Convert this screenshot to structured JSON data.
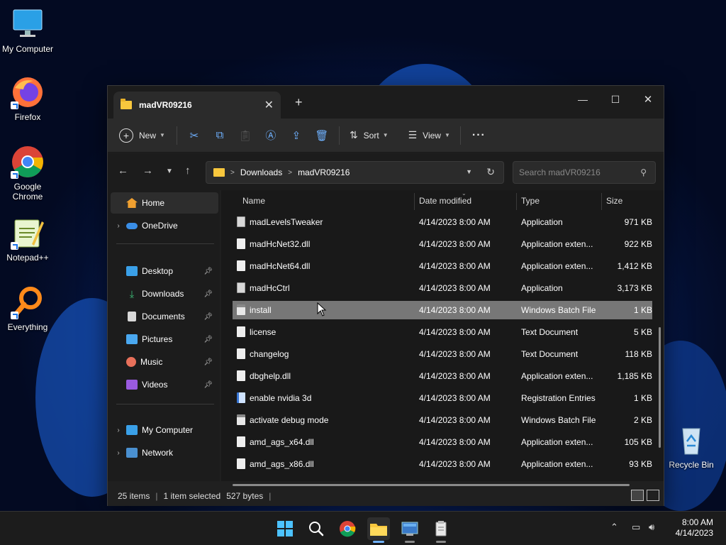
{
  "desktop": {
    "icons": [
      {
        "label": "My Computer"
      },
      {
        "label": "Firefox"
      },
      {
        "label": "Google Chrome"
      },
      {
        "label": "Notepad++"
      },
      {
        "label": "Everything"
      },
      {
        "label": "Recycle Bin"
      }
    ]
  },
  "window": {
    "tab_title": "madVR09216",
    "tab_close": "✕",
    "new_tab": "+",
    "minimize": "—",
    "maximize": "☐",
    "close": "✕"
  },
  "toolbar": {
    "new_label": "New",
    "sort_label": "Sort",
    "view_label": "View",
    "more_label": "···"
  },
  "address": {
    "crumbs": [
      "Downloads",
      "madVR09216"
    ],
    "search_placeholder": "Search madVR09216"
  },
  "sidebar": {
    "items": [
      {
        "label": "Home"
      },
      {
        "label": "OneDrive"
      },
      {
        "label": "Desktop"
      },
      {
        "label": "Downloads"
      },
      {
        "label": "Documents"
      },
      {
        "label": "Pictures"
      },
      {
        "label": "Music"
      },
      {
        "label": "Videos"
      },
      {
        "label": "My Computer"
      },
      {
        "label": "Network"
      }
    ]
  },
  "columns": {
    "name": "Name",
    "date": "Date modified",
    "type": "Type",
    "size": "Size"
  },
  "files": [
    {
      "name": "madLevelsTweaker",
      "date": "4/14/2023 8:00 AM",
      "type": "Application",
      "size": "971 KB"
    },
    {
      "name": "madHcNet32.dll",
      "date": "4/14/2023 8:00 AM",
      "type": "Application exten...",
      "size": "922 KB"
    },
    {
      "name": "madHcNet64.dll",
      "date": "4/14/2023 8:00 AM",
      "type": "Application exten...",
      "size": "1,412 KB"
    },
    {
      "name": "madHcCtrl",
      "date": "4/14/2023 8:00 AM",
      "type": "Application",
      "size": "3,173 KB"
    },
    {
      "name": "install",
      "date": "4/14/2023 8:00 AM",
      "type": "Windows Batch File",
      "size": "1 KB"
    },
    {
      "name": "license",
      "date": "4/14/2023 8:00 AM",
      "type": "Text Document",
      "size": "5 KB"
    },
    {
      "name": "changelog",
      "date": "4/14/2023 8:00 AM",
      "type": "Text Document",
      "size": "118 KB"
    },
    {
      "name": "dbghelp.dll",
      "date": "4/14/2023 8:00 AM",
      "type": "Application exten...",
      "size": "1,185 KB"
    },
    {
      "name": "enable nvidia 3d",
      "date": "4/14/2023 8:00 AM",
      "type": "Registration Entries",
      "size": "1 KB"
    },
    {
      "name": "activate debug mode",
      "date": "4/14/2023 8:00 AM",
      "type": "Windows Batch File",
      "size": "2 KB"
    },
    {
      "name": "amd_ags_x64.dll",
      "date": "4/14/2023 8:00 AM",
      "type": "Application exten...",
      "size": "105 KB"
    },
    {
      "name": "amd_ags_x86.dll",
      "date": "4/14/2023 8:00 AM",
      "type": "Application exten...",
      "size": "93 KB"
    }
  ],
  "status": {
    "items": "25 items",
    "selected": "1 item selected",
    "size": "527 bytes"
  },
  "taskbar": {
    "time": "8:00 AM",
    "date": "4/14/2023"
  }
}
